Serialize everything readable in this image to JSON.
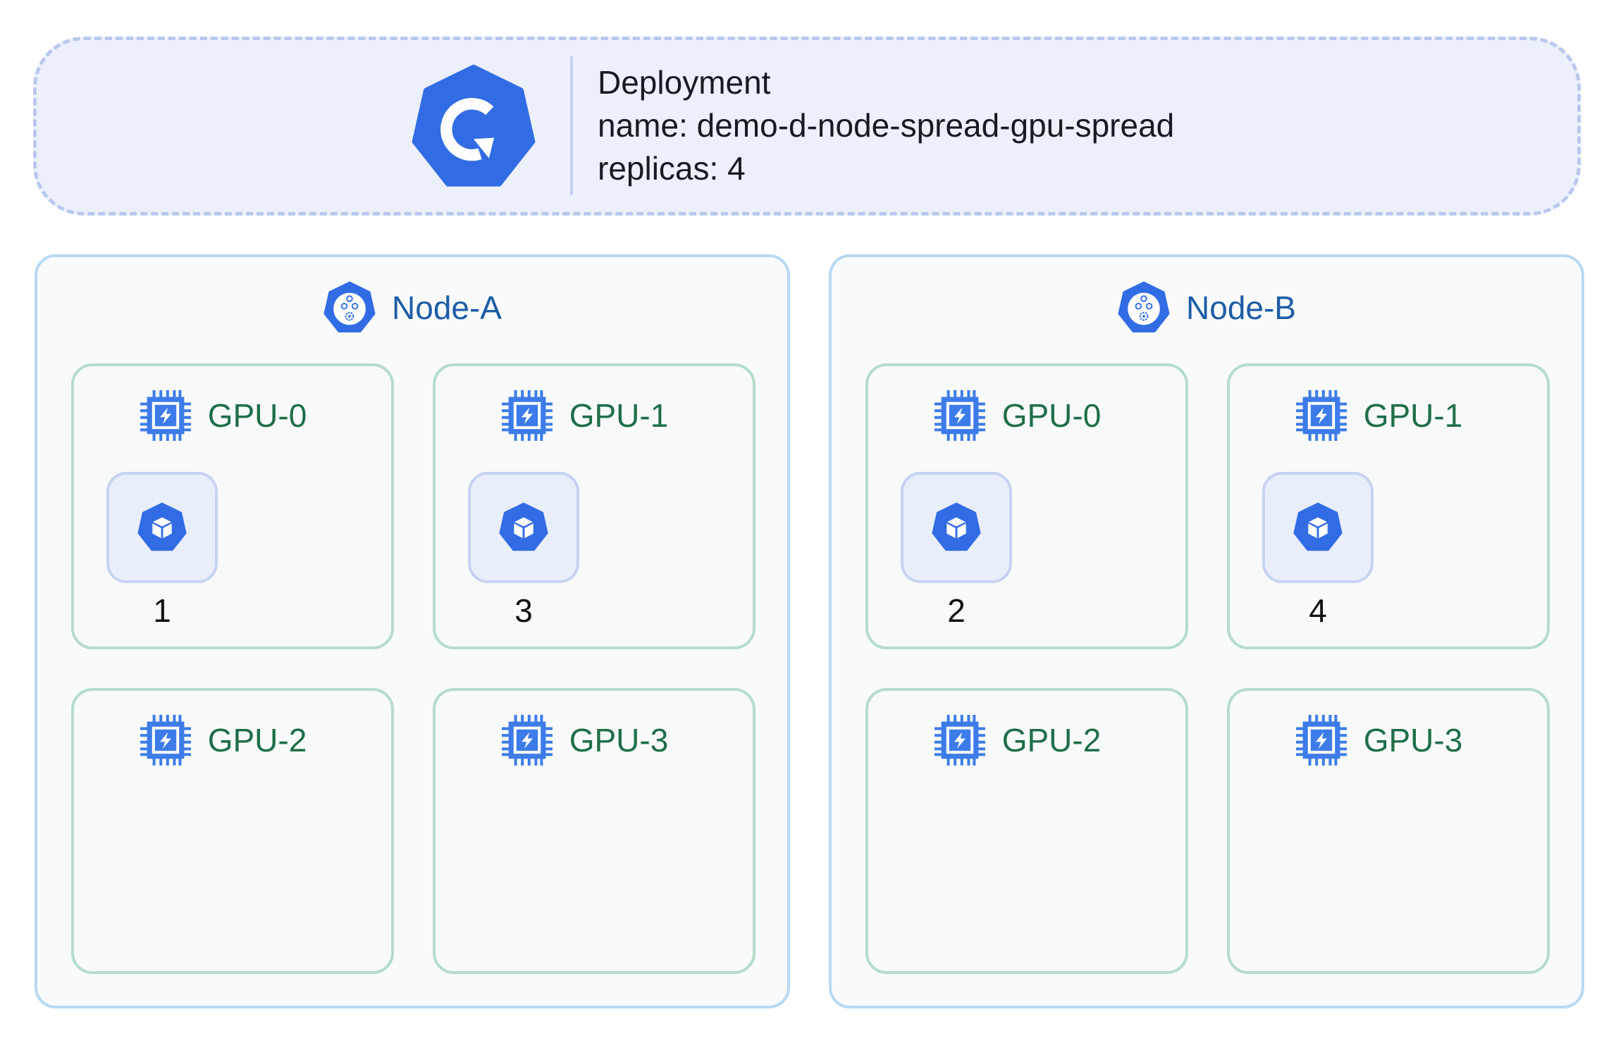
{
  "deployment": {
    "title": "Deployment",
    "name_line": "name: demo-d-node-spread-gpu-spread",
    "replicas_line": "replicas: 4"
  },
  "nodes": [
    {
      "label": "Node-A",
      "gpus": [
        {
          "label": "GPU-0",
          "pod": "1"
        },
        {
          "label": "GPU-1",
          "pod": "3"
        },
        {
          "label": "GPU-2",
          "pod": null
        },
        {
          "label": "GPU-3",
          "pod": null
        }
      ]
    },
    {
      "label": "Node-B",
      "gpus": [
        {
          "label": "GPU-0",
          "pod": "2"
        },
        {
          "label": "GPU-1",
          "pod": "4"
        },
        {
          "label": "GPU-2",
          "pod": null
        },
        {
          "label": "GPU-3",
          "pod": null
        }
      ]
    }
  ],
  "icons": {
    "deployment": "kubernetes-deployment-icon",
    "node": "kubernetes-node-icon",
    "gpu": "gpu-chip-icon",
    "pod": "kubernetes-pod-icon"
  },
  "colors": {
    "k8s_blue": "#326CE5",
    "deployment_fill": "#ECF0FC",
    "deployment_border": "#B8C8EE",
    "node_border": "#B7D9F4",
    "node_text": "#1E5CA6",
    "gpu_border": "#B5DCCB",
    "gpu_text": "#1F6E49",
    "pod_fill": "#E9EEFB",
    "pod_border": "#C6D3F2"
  }
}
